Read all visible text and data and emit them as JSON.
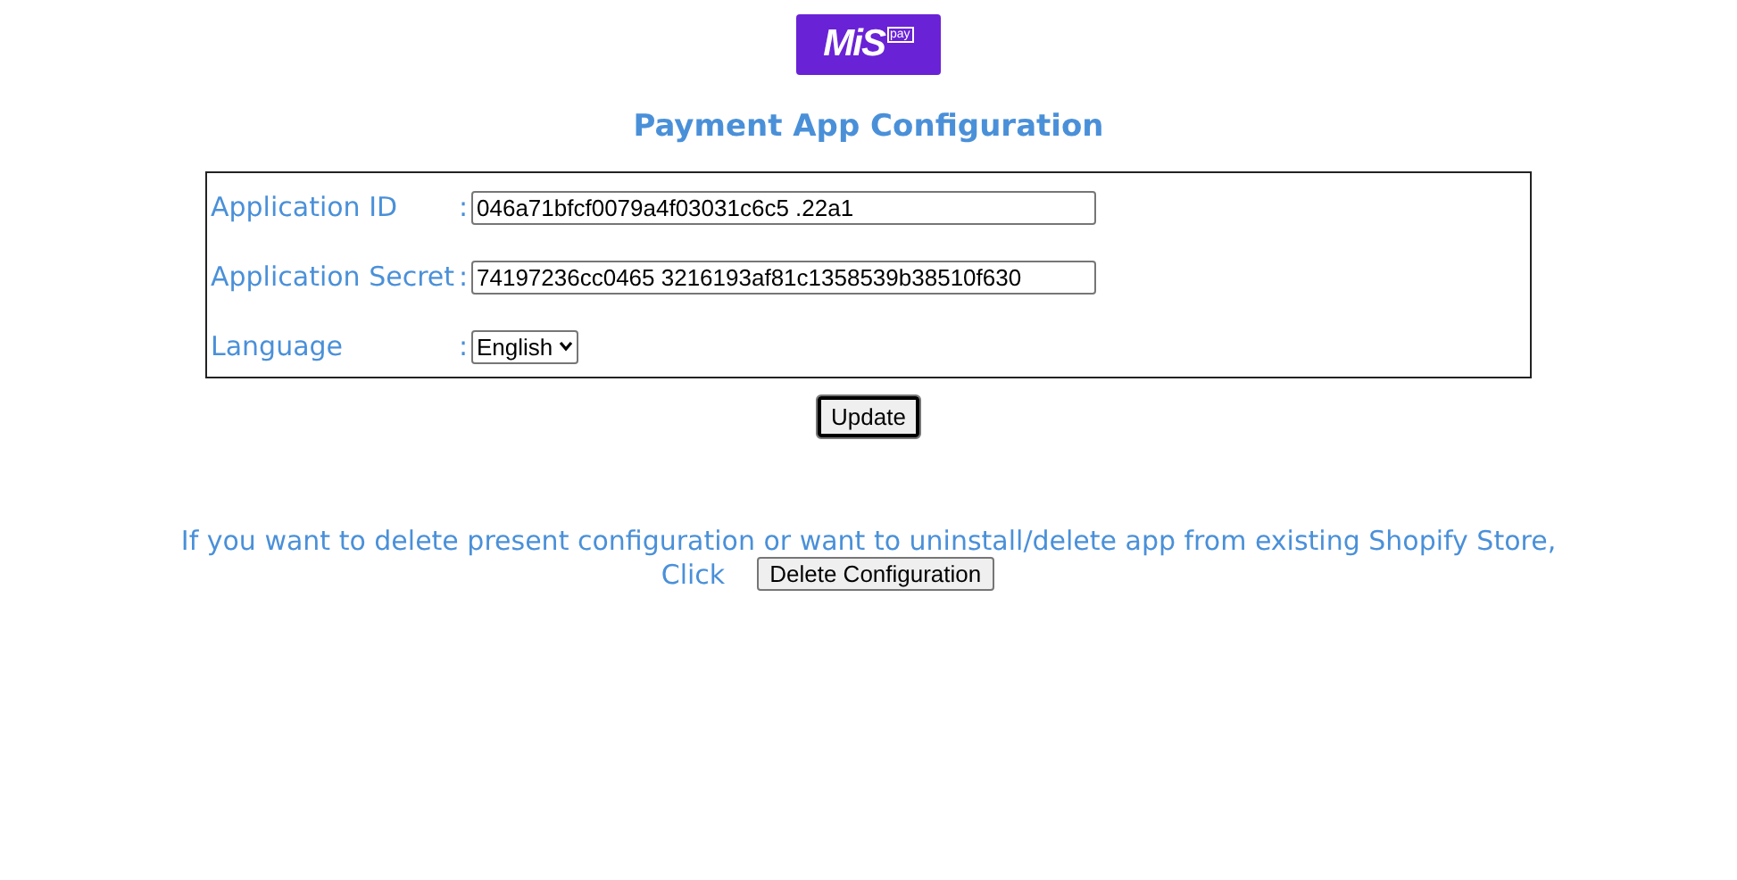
{
  "logo": {
    "name": "MiS",
    "suffix": "pay"
  },
  "title": "Payment App Configuration",
  "fields": [
    {
      "kind": "text",
      "label": "Application ID",
      "separator": ":",
      "value": "046a71bfcf0079a4f03031c6c5 .22a1"
    },
    {
      "kind": "text",
      "label": "Application Secret",
      "separator": ":",
      "value": "74197236cc0465 3216193af81c1358539b38510f630"
    },
    {
      "kind": "select",
      "label": "Language",
      "separator": ":",
      "value": "English"
    }
  ],
  "update_button": "Update",
  "delete_note": {
    "text": "If you want to delete present configuration or want to uninstall/delete app from existing Shopify Store,",
    "click_label": "Click",
    "button": "Delete Configuration"
  }
}
